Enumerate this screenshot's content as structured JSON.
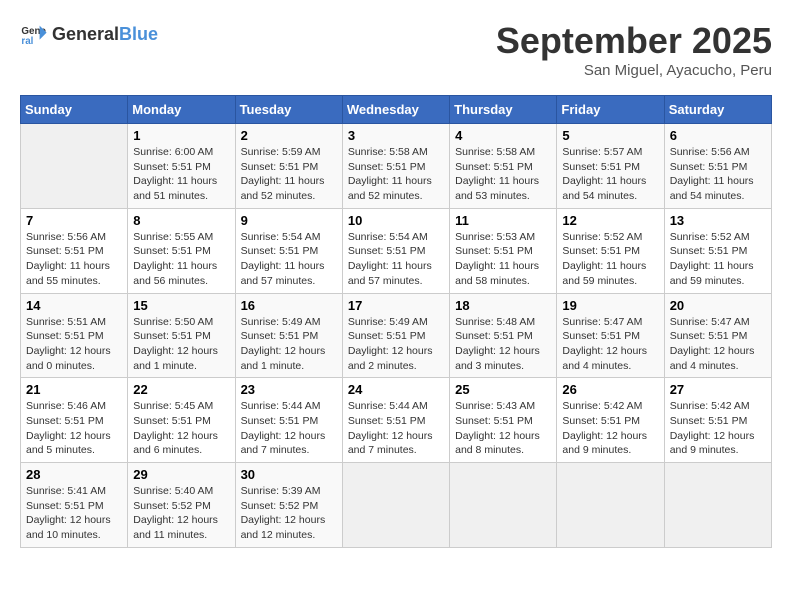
{
  "header": {
    "logo_general": "General",
    "logo_blue": "Blue",
    "month": "September 2025",
    "location": "San Miguel, Ayacucho, Peru"
  },
  "weekdays": [
    "Sunday",
    "Monday",
    "Tuesday",
    "Wednesday",
    "Thursday",
    "Friday",
    "Saturday"
  ],
  "weeks": [
    [
      {
        "day": "",
        "info": ""
      },
      {
        "day": "1",
        "info": "Sunrise: 6:00 AM\nSunset: 5:51 PM\nDaylight: 11 hours\nand 51 minutes."
      },
      {
        "day": "2",
        "info": "Sunrise: 5:59 AM\nSunset: 5:51 PM\nDaylight: 11 hours\nand 52 minutes."
      },
      {
        "day": "3",
        "info": "Sunrise: 5:58 AM\nSunset: 5:51 PM\nDaylight: 11 hours\nand 52 minutes."
      },
      {
        "day": "4",
        "info": "Sunrise: 5:58 AM\nSunset: 5:51 PM\nDaylight: 11 hours\nand 53 minutes."
      },
      {
        "day": "5",
        "info": "Sunrise: 5:57 AM\nSunset: 5:51 PM\nDaylight: 11 hours\nand 54 minutes."
      },
      {
        "day": "6",
        "info": "Sunrise: 5:56 AM\nSunset: 5:51 PM\nDaylight: 11 hours\nand 54 minutes."
      }
    ],
    [
      {
        "day": "7",
        "info": "Sunrise: 5:56 AM\nSunset: 5:51 PM\nDaylight: 11 hours\nand 55 minutes."
      },
      {
        "day": "8",
        "info": "Sunrise: 5:55 AM\nSunset: 5:51 PM\nDaylight: 11 hours\nand 56 minutes."
      },
      {
        "day": "9",
        "info": "Sunrise: 5:54 AM\nSunset: 5:51 PM\nDaylight: 11 hours\nand 57 minutes."
      },
      {
        "day": "10",
        "info": "Sunrise: 5:54 AM\nSunset: 5:51 PM\nDaylight: 11 hours\nand 57 minutes."
      },
      {
        "day": "11",
        "info": "Sunrise: 5:53 AM\nSunset: 5:51 PM\nDaylight: 11 hours\nand 58 minutes."
      },
      {
        "day": "12",
        "info": "Sunrise: 5:52 AM\nSunset: 5:51 PM\nDaylight: 11 hours\nand 59 minutes."
      },
      {
        "day": "13",
        "info": "Sunrise: 5:52 AM\nSunset: 5:51 PM\nDaylight: 11 hours\nand 59 minutes."
      }
    ],
    [
      {
        "day": "14",
        "info": "Sunrise: 5:51 AM\nSunset: 5:51 PM\nDaylight: 12 hours\nand 0 minutes."
      },
      {
        "day": "15",
        "info": "Sunrise: 5:50 AM\nSunset: 5:51 PM\nDaylight: 12 hours\nand 1 minute."
      },
      {
        "day": "16",
        "info": "Sunrise: 5:49 AM\nSunset: 5:51 PM\nDaylight: 12 hours\nand 1 minute."
      },
      {
        "day": "17",
        "info": "Sunrise: 5:49 AM\nSunset: 5:51 PM\nDaylight: 12 hours\nand 2 minutes."
      },
      {
        "day": "18",
        "info": "Sunrise: 5:48 AM\nSunset: 5:51 PM\nDaylight: 12 hours\nand 3 minutes."
      },
      {
        "day": "19",
        "info": "Sunrise: 5:47 AM\nSunset: 5:51 PM\nDaylight: 12 hours\nand 4 minutes."
      },
      {
        "day": "20",
        "info": "Sunrise: 5:47 AM\nSunset: 5:51 PM\nDaylight: 12 hours\nand 4 minutes."
      }
    ],
    [
      {
        "day": "21",
        "info": "Sunrise: 5:46 AM\nSunset: 5:51 PM\nDaylight: 12 hours\nand 5 minutes."
      },
      {
        "day": "22",
        "info": "Sunrise: 5:45 AM\nSunset: 5:51 PM\nDaylight: 12 hours\nand 6 minutes."
      },
      {
        "day": "23",
        "info": "Sunrise: 5:44 AM\nSunset: 5:51 PM\nDaylight: 12 hours\nand 7 minutes."
      },
      {
        "day": "24",
        "info": "Sunrise: 5:44 AM\nSunset: 5:51 PM\nDaylight: 12 hours\nand 7 minutes."
      },
      {
        "day": "25",
        "info": "Sunrise: 5:43 AM\nSunset: 5:51 PM\nDaylight: 12 hours\nand 8 minutes."
      },
      {
        "day": "26",
        "info": "Sunrise: 5:42 AM\nSunset: 5:51 PM\nDaylight: 12 hours\nand 9 minutes."
      },
      {
        "day": "27",
        "info": "Sunrise: 5:42 AM\nSunset: 5:51 PM\nDaylight: 12 hours\nand 9 minutes."
      }
    ],
    [
      {
        "day": "28",
        "info": "Sunrise: 5:41 AM\nSunset: 5:51 PM\nDaylight: 12 hours\nand 10 minutes."
      },
      {
        "day": "29",
        "info": "Sunrise: 5:40 AM\nSunset: 5:52 PM\nDaylight: 12 hours\nand 11 minutes."
      },
      {
        "day": "30",
        "info": "Sunrise: 5:39 AM\nSunset: 5:52 PM\nDaylight: 12 hours\nand 12 minutes."
      },
      {
        "day": "",
        "info": ""
      },
      {
        "day": "",
        "info": ""
      },
      {
        "day": "",
        "info": ""
      },
      {
        "day": "",
        "info": ""
      }
    ]
  ]
}
